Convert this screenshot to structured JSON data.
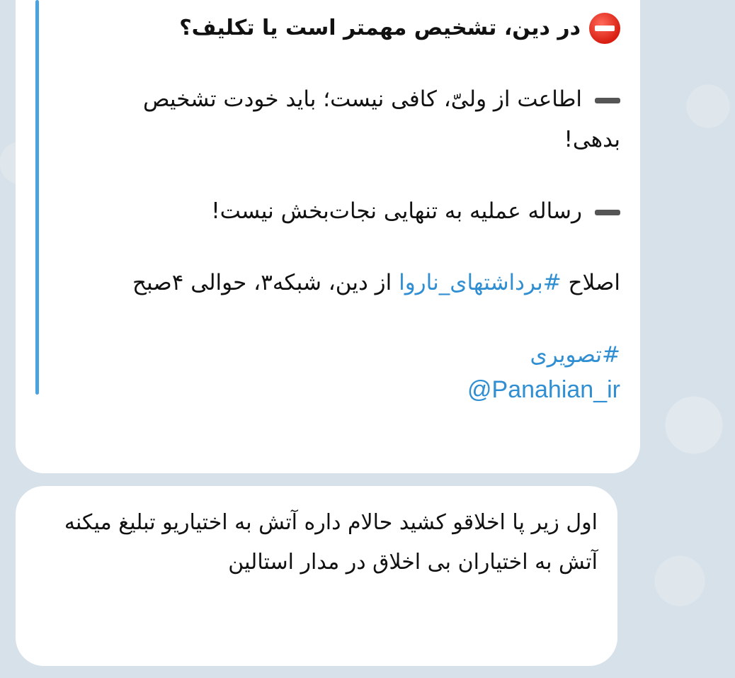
{
  "messages": [
    {
      "headline": "در دین، تشخیص مهمتر است یا تکلیف؟",
      "line1": "اطاعت از ولیّ، کافی نیست؛ باید خودت تشخیص بدهی!",
      "line2": "رساله عملیه به تنهایی نجات‌بخش نیست!",
      "line3_prefix": "اصلاح ",
      "line3_hashtag": "#برداشتهای_ناروا",
      "line3_suffix": " از دین، شبکه۳، حوالی ۴صبح",
      "hashtag": "#تصویری",
      "handle": "@Panahian_ir"
    },
    {
      "line1": "اول زیر پا اخلاقو کشید حالام داره آتش به اختیاریو تبلیغ میکنه",
      "line2": "آتش به اختیاران بی اخلاق در مدار استالین"
    }
  ],
  "icons": {
    "stop": "stop-sign-icon"
  },
  "colors": {
    "link": "#2f8fd2",
    "quote_bar": "#4aa3df",
    "background": "#d7e1e9"
  }
}
